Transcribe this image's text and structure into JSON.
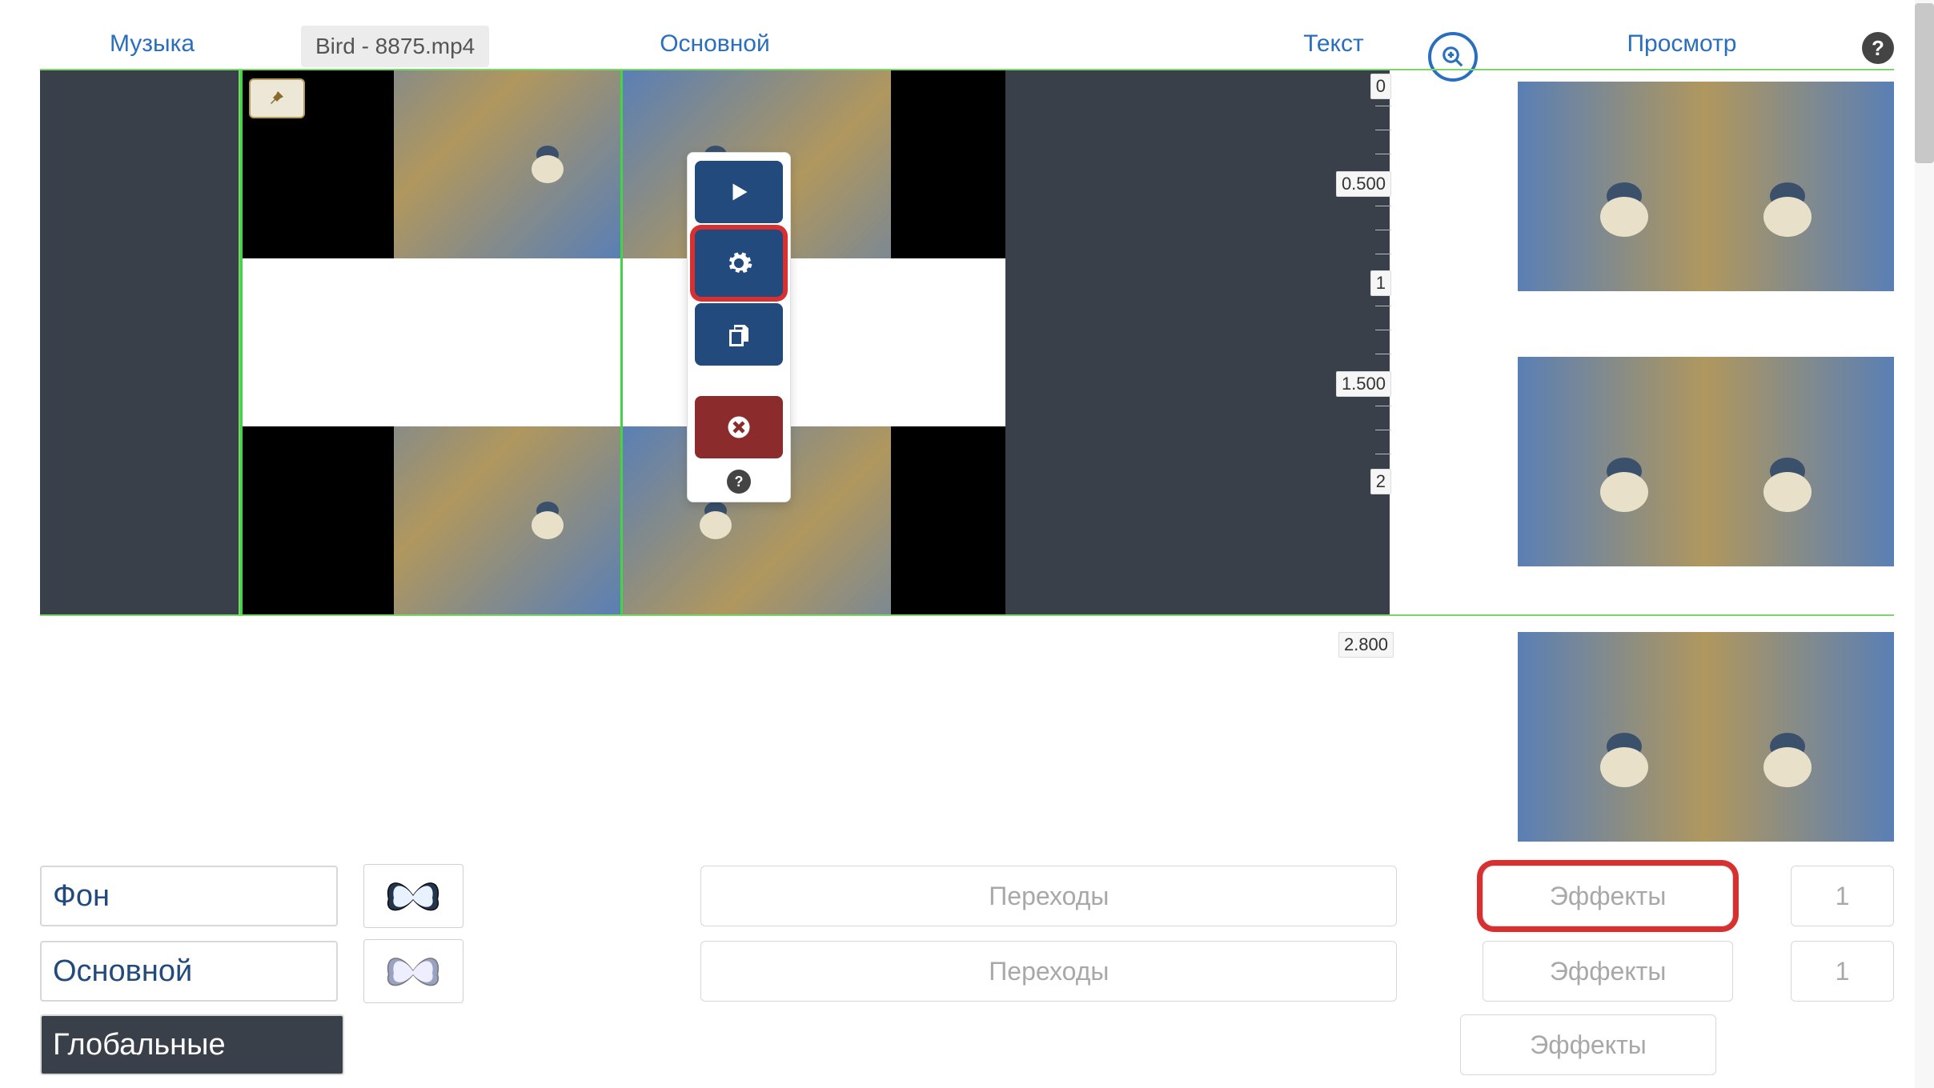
{
  "filename": "Bird - 8875.mp4",
  "tabs": {
    "music": "Музыка",
    "main": "Основной",
    "text": "Текст",
    "preview": "Просмотр"
  },
  "timeline": {
    "ticks": [
      "0",
      "0.500",
      "1",
      "1.500",
      "2"
    ],
    "end_tick": "2.800"
  },
  "clip_menu": {
    "play": "play",
    "settings": "settings",
    "copy": "copy",
    "delete": "delete"
  },
  "bottom": {
    "layers": {
      "background": "Фон",
      "main": "Основной",
      "global": "Глобальные"
    },
    "transitions_label": "Переходы",
    "effects_label": "Эффекты",
    "counts": {
      "row1": "1",
      "row2": "1"
    }
  },
  "icons": {
    "zoom": "zoom-in",
    "help": "?",
    "pin": "pin"
  }
}
